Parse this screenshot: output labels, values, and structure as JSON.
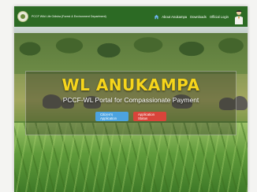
{
  "header": {
    "brand": "PCCF Wild Life Odisha (Forest & Environment Department)",
    "nav": [
      {
        "label": "About Anukampa"
      },
      {
        "label": "Downloads"
      },
      {
        "label": "Official Login"
      }
    ]
  },
  "hero": {
    "title": "WL ANUKAMPA",
    "subtitle": "PCCF-WL Portal for Compassionate Payment",
    "buttons": [
      {
        "label": "Citizen's Application",
        "color": "#4ca3e0"
      },
      {
        "label": "Application Status",
        "color": "#d9443a"
      }
    ]
  },
  "icons": [
    "emblem-logo",
    "home-icon",
    "officer-avatar"
  ],
  "colors": {
    "navbar": "#2c6a24",
    "title": "#f6d51c"
  }
}
